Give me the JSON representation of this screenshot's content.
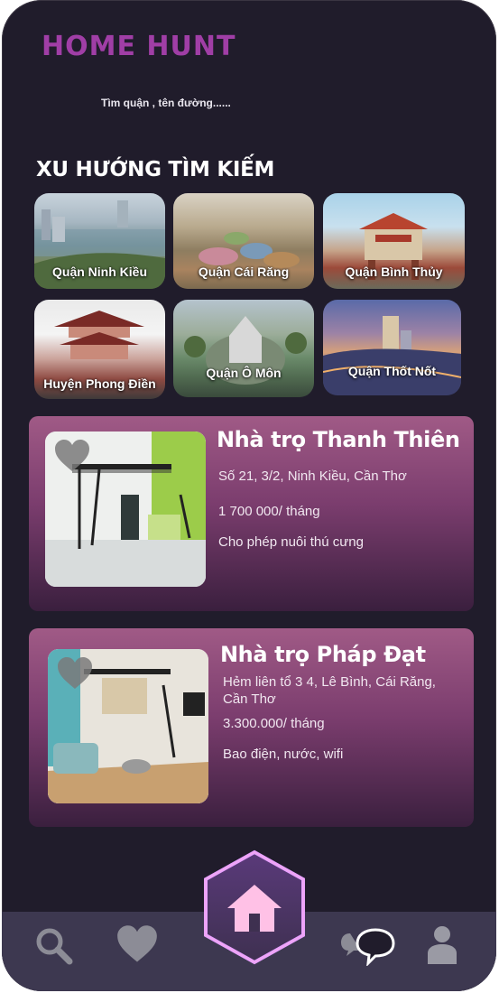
{
  "app": {
    "logo": "HOME HUNT"
  },
  "search": {
    "placeholder": "Tìm quận , tên đường......"
  },
  "trending": {
    "title": "XU HƯỚNG TÌM KIẾM",
    "items": [
      {
        "label": "Quận Ninh Kiều"
      },
      {
        "label": "Quận Cái Răng"
      },
      {
        "label": "Quận Bình Thủy"
      },
      {
        "label": "Huyện Phong Điền"
      },
      {
        "label": "Quận Ô Môn"
      },
      {
        "label": "Quận Thốt Nốt"
      }
    ]
  },
  "listings": [
    {
      "title": "Nhà trọ Thanh Thiên",
      "address": "Số 21, 3/2, Ninh Kiều, Cần Thơ",
      "price": "1 700 000/ tháng",
      "note": "Cho phép nuôi thú cưng"
    },
    {
      "title": "Nhà trọ Pháp Đạt",
      "address_line1": "Hẻm liên tổ 3 4, Lê Bình, Cái Răng,",
      "address_line2": "Cần Thơ",
      "price": "3.300.000/ tháng",
      "note": "Bao điện, nước, wifi"
    }
  ],
  "nav": {
    "items": [
      "search-icon",
      "heart-icon",
      "home-icon",
      "chat-icon",
      "user-icon"
    ],
    "accent": "#ff9de0"
  }
}
